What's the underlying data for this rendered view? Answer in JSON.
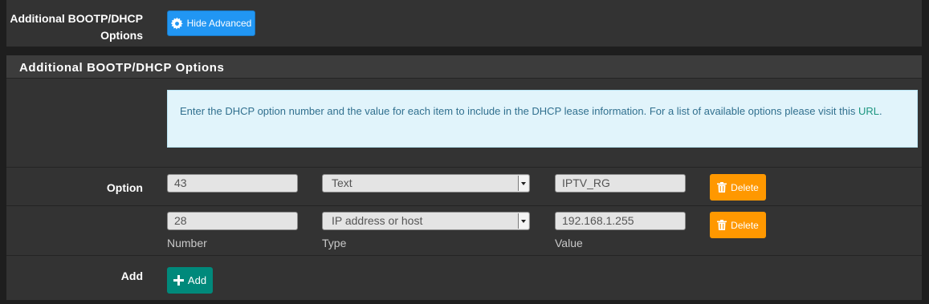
{
  "top_row": {
    "label_line1": "Additional BOOTP/DHCP",
    "label_line2": "Options",
    "hide_advanced_label": "Hide Advanced"
  },
  "section": {
    "title": "Additional BOOTP/DHCP Options",
    "info_text": "Enter the DHCP option number and the value for each item to include in the DHCP lease information. For a list of available options please visit this",
    "info_link": "URL",
    "info_suffix": "."
  },
  "option_label": "Option",
  "rows": [
    {
      "number": "43",
      "type": "Text",
      "value": "IPTV_RG",
      "delete_label": "Delete"
    },
    {
      "number": "28",
      "type": "IP address or host",
      "value": "192.168.1.255",
      "delete_label": "Delete"
    }
  ],
  "hints": {
    "number": "Number",
    "type": "Type",
    "value": "Value"
  },
  "add_row": {
    "label": "Add",
    "button_label": "Add"
  },
  "colors": {
    "hide_advanced": "#2196f3",
    "delete": "#ff9800",
    "add": "#00897b",
    "info_bg": "#e1f4fb"
  },
  "icons": {
    "hide_advanced": "gear-icon",
    "delete": "trash-icon",
    "add": "plus-icon"
  }
}
